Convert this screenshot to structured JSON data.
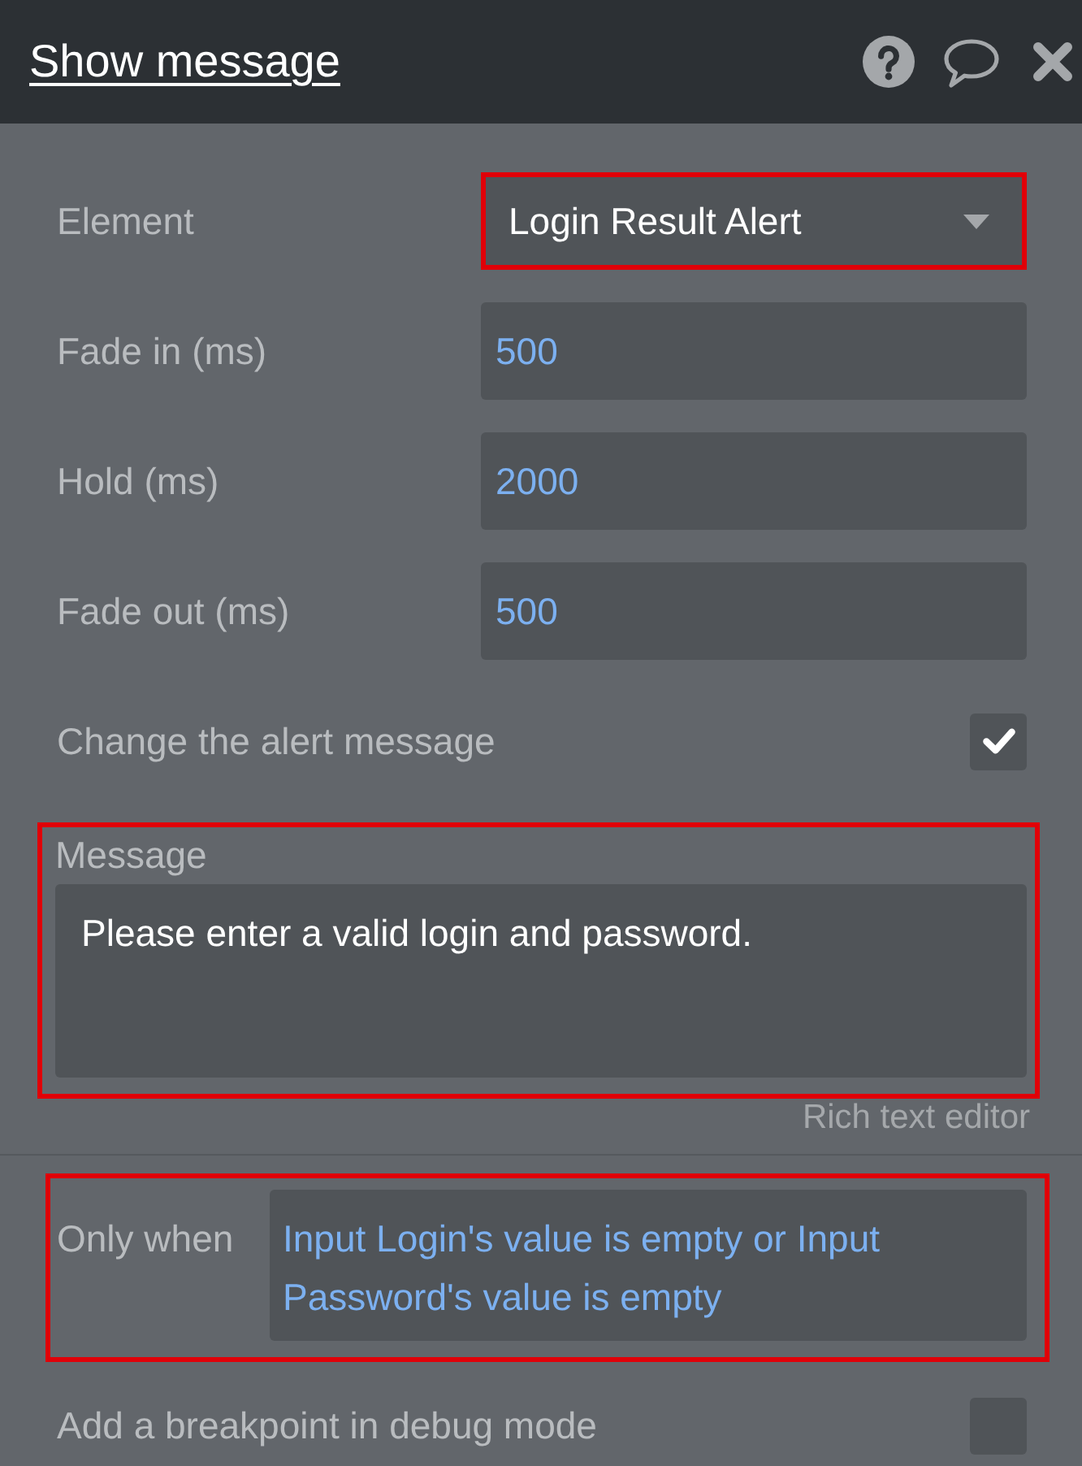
{
  "window": {
    "title": "Show message"
  },
  "fields": [
    {
      "kind": "dropdown",
      "label": "Element",
      "value": "Login Result Alert",
      "highlighted": true
    },
    {
      "kind": "number",
      "label": "Fade in (ms)",
      "value": "500",
      "highlighted": false
    },
    {
      "kind": "number",
      "label": "Hold (ms)",
      "value": "2000",
      "highlighted": false
    },
    {
      "kind": "number",
      "label": "Fade out (ms)",
      "value": "500",
      "highlighted": false
    },
    {
      "kind": "checkbox",
      "label": "Change the alert message",
      "checked": true
    },
    {
      "kind": "rich_text",
      "label": "Message",
      "value": "Please enter a valid login and password.",
      "link": "Rich text editor",
      "highlighted": true
    }
  ],
  "condition": {
    "label": "Only when",
    "value": "Input Login's value is empty or Input Password's value is empty",
    "highlighted": true
  },
  "debug": {
    "label": "Add a breakpoint in debug mode",
    "checked": false
  }
}
